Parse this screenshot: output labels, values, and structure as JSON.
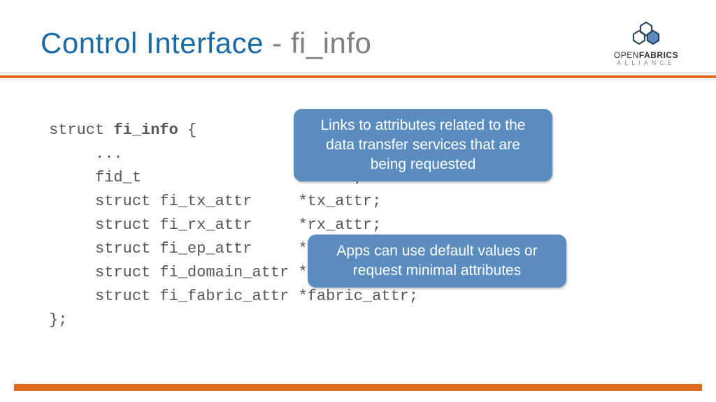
{
  "title": {
    "main": "Control Interface",
    "separator": " - ",
    "sub": "fi_info"
  },
  "logo": {
    "line1a": "OPEN",
    "line1b": "FABRICS",
    "line2": "ALLIANCE"
  },
  "code": {
    "l0a": "struct ",
    "l0b": "fi_info",
    "l0c": " {",
    "l1": "     ...",
    "l2": "     fid_t                 handle;",
    "l3": "     struct fi_tx_attr     *tx_attr;",
    "l4": "     struct fi_rx_attr     *rx_attr;",
    "l5": "     struct fi_ep_attr     *ep_attr;",
    "l6": "     struct fi_domain_attr *domain_attr;",
    "l7": "     struct fi_fabric_attr *fabric_attr;",
    "l8": "};"
  },
  "callouts": {
    "c1": "Links to attributes related to the data transfer services that are being requested",
    "c2": "Apps can use default values or request minimal attributes"
  }
}
